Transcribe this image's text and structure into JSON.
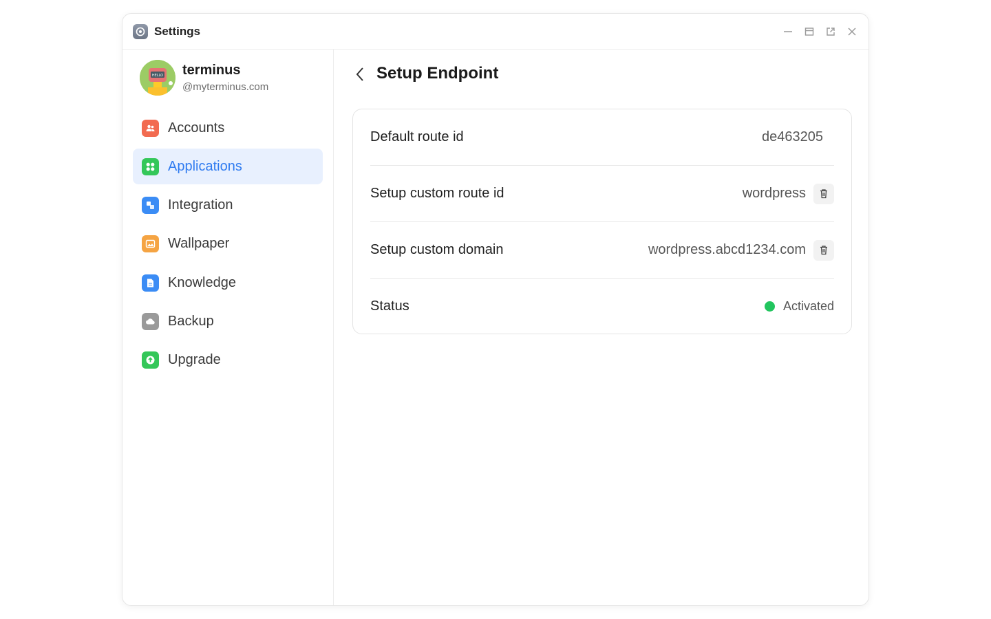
{
  "window": {
    "title": "Settings"
  },
  "profile": {
    "name": "terminus",
    "handle": "@myterminus.com"
  },
  "sidebar": {
    "items": [
      {
        "label": "Accounts",
        "icon": "accounts-icon",
        "color": "#f26b50",
        "active": false
      },
      {
        "label": "Applications",
        "icon": "applications-icon",
        "color": "#34c759",
        "active": true
      },
      {
        "label": "Integration",
        "icon": "integration-icon",
        "color": "#3b8cf5",
        "active": false
      },
      {
        "label": "Wallpaper",
        "icon": "wallpaper-icon",
        "color": "#f5a443",
        "active": false
      },
      {
        "label": "Knowledge",
        "icon": "knowledge-icon",
        "color": "#3b8cf5",
        "active": false
      },
      {
        "label": "Backup",
        "icon": "backup-icon",
        "color": "#9a9a9a",
        "active": false
      },
      {
        "label": "Upgrade",
        "icon": "upgrade-icon",
        "color": "#34c759",
        "active": false
      }
    ]
  },
  "main": {
    "title": "Setup Endpoint",
    "rows": [
      {
        "label": "Default route id",
        "value": "de463205"
      },
      {
        "label": "Setup custom route id",
        "value": "wordpress"
      },
      {
        "label": "Setup custom domain",
        "value": "wordpress.abcd1234.com"
      },
      {
        "label": "Status",
        "value": "Activated"
      }
    ],
    "status_color": "#22c55e"
  },
  "colors": {
    "accent": "#2f7bf0",
    "active_bg": "#e8f0fe"
  }
}
